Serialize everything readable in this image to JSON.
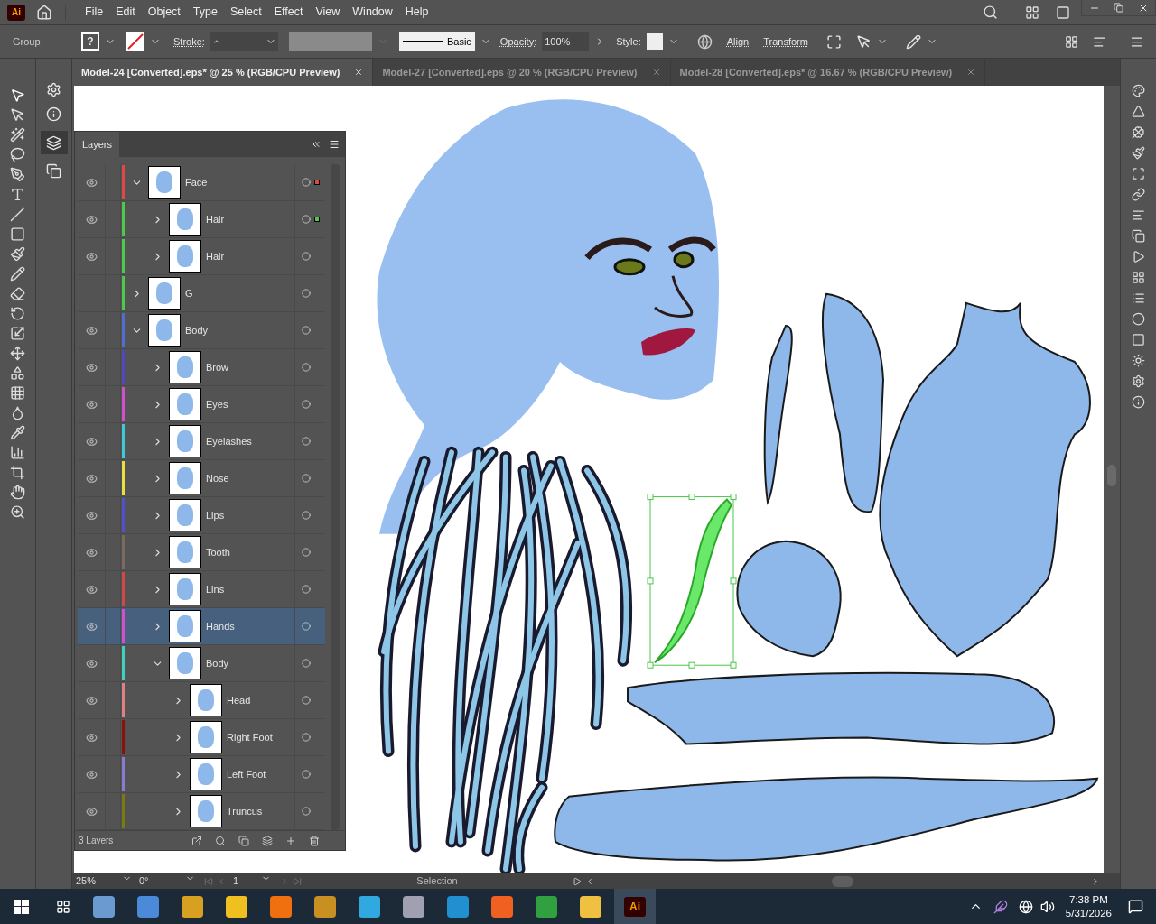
{
  "app": {
    "logo": "Ai"
  },
  "menu": [
    "File",
    "Edit",
    "Object",
    "Type",
    "Select",
    "Effect",
    "View",
    "Window",
    "Help"
  ],
  "control_bar": {
    "selection_type": "Group",
    "fill_value": "?",
    "stroke_label": "Stroke:",
    "brush": "Basic",
    "opacity_label": "Opacity:",
    "opacity": "100%",
    "style_label": "Style:",
    "buttons": [
      "Align",
      "Transform"
    ]
  },
  "document_tabs": [
    {
      "title": "Model-24 [Converted].eps* @ 25 % (RGB/CPU Preview)",
      "selected": true
    },
    {
      "title": "Model-27 [Converted].eps @ 20 % (RGB/CPU Preview)",
      "selected": false
    },
    {
      "title": "Model-28 [Converted].eps* @ 16.67 % (RGB/CPU Preview)",
      "selected": false
    }
  ],
  "layers_panel": {
    "title": "Layers",
    "count": "3 Layers",
    "layers": [
      {
        "name": "Face",
        "color": "#e04848",
        "visible": true,
        "expanded": true,
        "selected": false,
        "has_selection": true,
        "children": [
          {
            "name": "Hair",
            "color": "#4cc84c",
            "visible": true,
            "expanded": false,
            "selected": false,
            "has_selection": true
          },
          {
            "name": "Hair",
            "color": "#4cc84c",
            "visible": true,
            "expanded": false,
            "selected": false,
            "has_selection": false
          }
        ]
      },
      {
        "name": "G",
        "color": "#4cc84c",
        "visible": false,
        "expanded": false,
        "selected": false,
        "has_selection": false
      },
      {
        "name": "Body",
        "color": "#4f6fd0",
        "visible": true,
        "expanded": true,
        "selected": false,
        "has_selection": false,
        "children": [
          {
            "name": "Brow",
            "color": "#5048c0",
            "visible": true,
            "expanded": false,
            "selected": false,
            "has_selection": false
          },
          {
            "name": "Eyes",
            "color": "#d050d0",
            "visible": true,
            "expanded": false,
            "selected": false,
            "has_selection": false
          },
          {
            "name": "Eyelashes",
            "color": "#40c8d8",
            "visible": true,
            "expanded": false,
            "selected": false,
            "has_selection": false
          },
          {
            "name": "Nose",
            "color": "#e8e040",
            "visible": true,
            "expanded": false,
            "selected": false,
            "has_selection": false
          },
          {
            "name": "Lips",
            "color": "#5050d0",
            "visible": true,
            "expanded": false,
            "selected": false,
            "has_selection": false
          },
          {
            "name": "Tooth",
            "color": "#7a6a60",
            "visible": true,
            "expanded": false,
            "selected": false,
            "has_selection": false
          },
          {
            "name": "Lins",
            "color": "#d04848",
            "visible": true,
            "expanded": false,
            "selected": false,
            "has_selection": false
          },
          {
            "name": "Hands",
            "color": "#d050d0",
            "visible": true,
            "expanded": false,
            "selected": true,
            "has_selection": false
          },
          {
            "name": "Body",
            "color": "#40d0c0",
            "visible": true,
            "expanded": true,
            "selected": false,
            "has_selection": false,
            "children": [
              {
                "name": "Head",
                "color": "#e08080",
                "visible": true,
                "expanded": false,
                "selected": false,
                "has_selection": false
              },
              {
                "name": "Right Foot",
                "color": "#8b1010",
                "visible": true,
                "expanded": false,
                "selected": false,
                "has_selection": false
              },
              {
                "name": "Left Foot",
                "color": "#8a7ad0",
                "visible": true,
                "expanded": false,
                "selected": false,
                "has_selection": false
              },
              {
                "name": "Truncus",
                "color": "#7a7a10",
                "visible": true,
                "expanded": false,
                "selected": false,
                "has_selection": false
              }
            ]
          }
        ]
      }
    ]
  },
  "status_bar": {
    "zoom": "25%",
    "rotation": "0°",
    "artboard": "1",
    "tool": "Selection"
  },
  "taskbar": {
    "active_app": "Ai",
    "time": "7:38 PM",
    "date": "5/31/2026"
  }
}
